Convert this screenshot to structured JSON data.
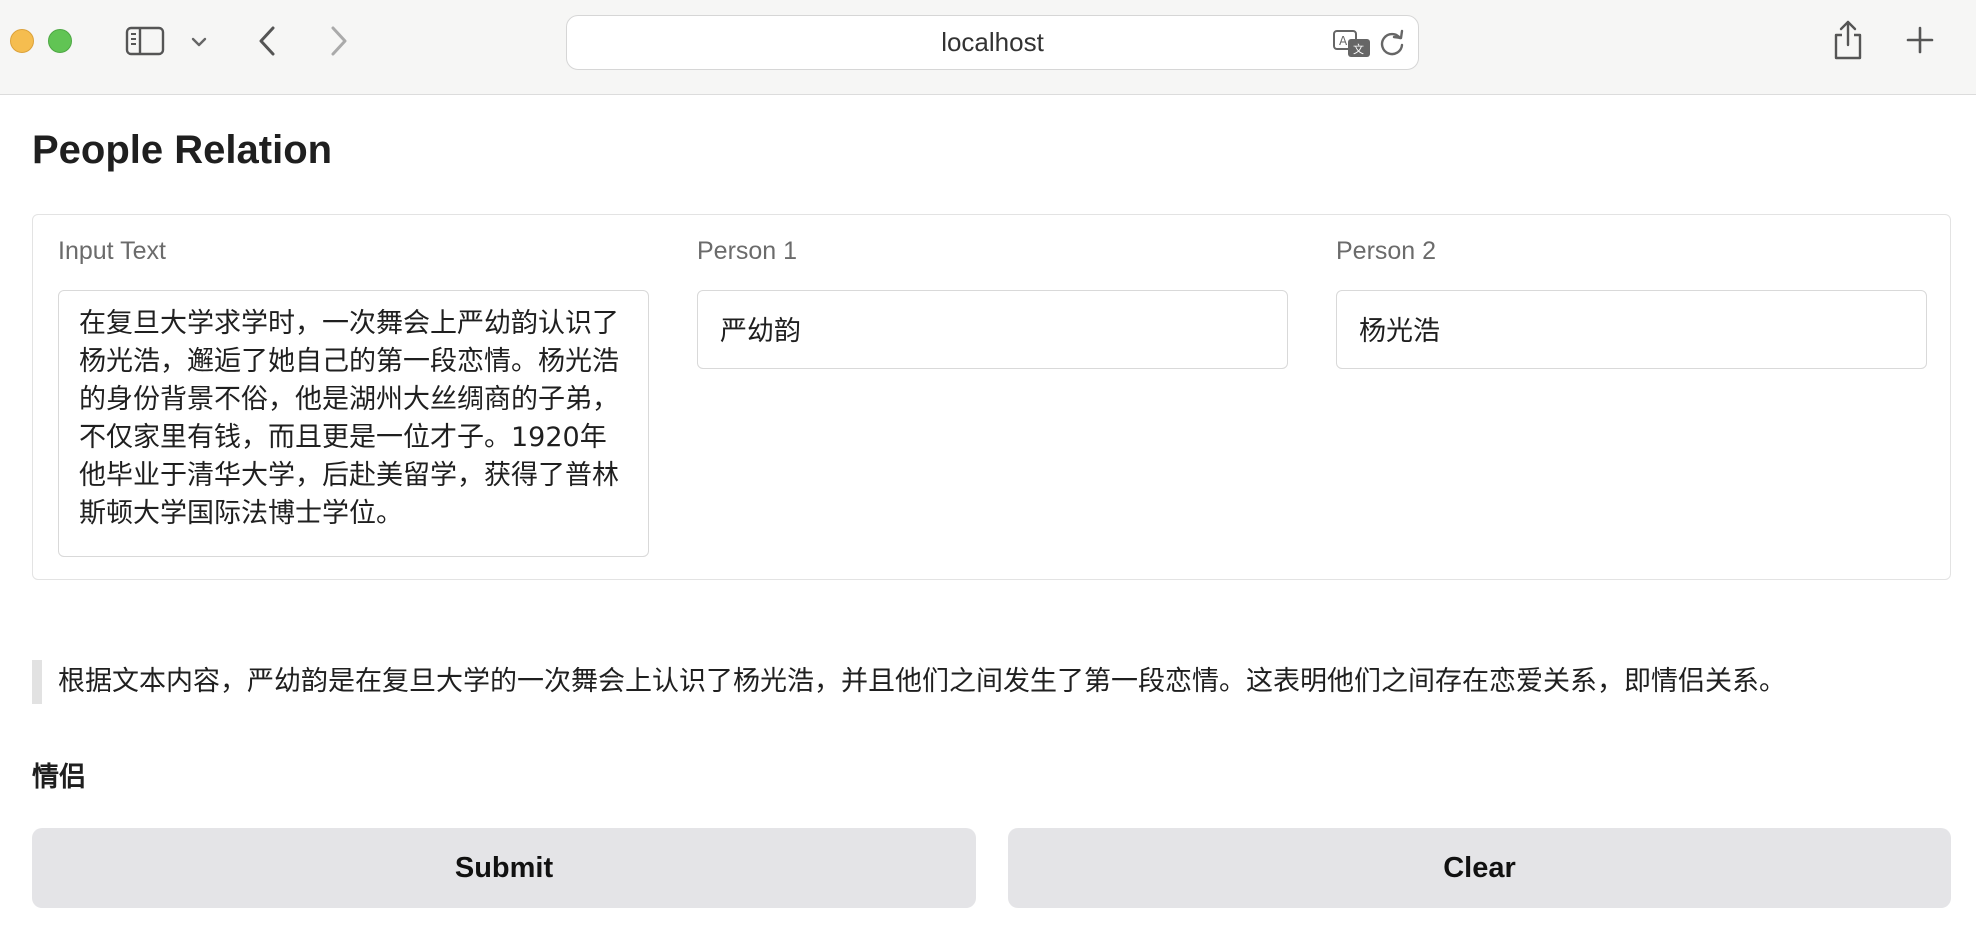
{
  "browser": {
    "address": "localhost"
  },
  "page": {
    "title": "People Relation"
  },
  "form": {
    "input_text": {
      "label": "Input Text",
      "value": "在复旦大学求学时，一次舞会上严幼韵认识了杨光浩，邂逅了她自己的第一段恋情。杨光浩的身份背景不俗，他是湖州大丝绸商的子弟，不仅家里有钱，而且更是一位才子。1920年他毕业于清华大学，后赴美留学，获得了普林斯顿大学国际法博士学位。"
    },
    "person1": {
      "label": "Person 1",
      "value": "严幼韵"
    },
    "person2": {
      "label": "Person 2",
      "value": "杨光浩"
    }
  },
  "output": {
    "explanation": "根据文本内容，严幼韵是在复旦大学的一次舞会上认识了杨光浩，并且他们之间发生了第一段恋情。这表明他们之间存在恋爱关系，即情侣关系。",
    "relation": "情侣"
  },
  "buttons": {
    "submit": "Submit",
    "clear": "Clear"
  }
}
